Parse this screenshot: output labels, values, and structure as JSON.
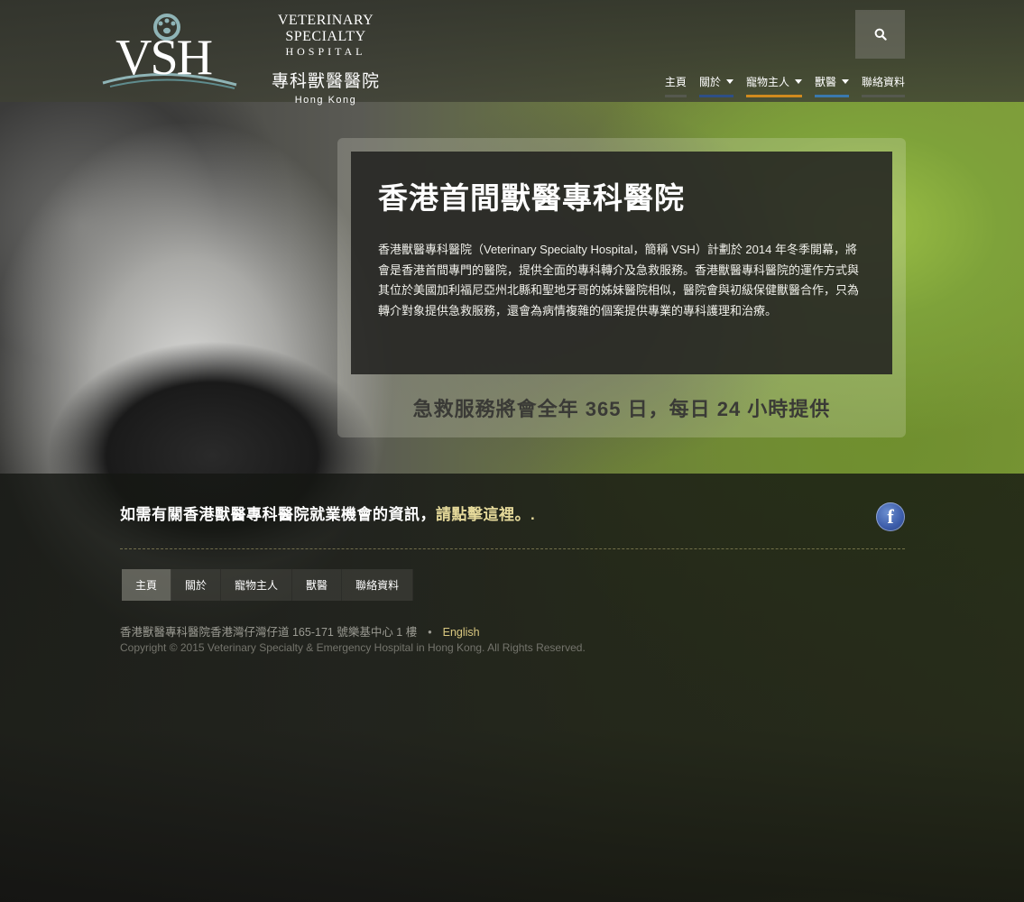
{
  "logo": {
    "mark_text": "VSH",
    "line1": "VETERINARY SPECIALTY",
    "line2": "HOSPITAL",
    "line3": "專科獸醫醫院",
    "line4": "Hong Kong"
  },
  "search": {
    "icon": "search-icon"
  },
  "nav": {
    "items": [
      {
        "label": "主頁",
        "has_dropdown": false,
        "bar_color": "#55584e"
      },
      {
        "label": "關於",
        "has_dropdown": true,
        "bar_color": "#2e4f86"
      },
      {
        "label": "寵物主人",
        "has_dropdown": true,
        "bar_color": "#d08a1e"
      },
      {
        "label": "獸醫",
        "has_dropdown": true,
        "bar_color": "#3a78ad"
      },
      {
        "label": "聯絡資料",
        "has_dropdown": false,
        "bar_color": "#55584e"
      }
    ]
  },
  "hero": {
    "title": "香港首間獸醫專科醫院",
    "body": "香港獸醫專科醫院（Veterinary Specialty Hospital，簡稱 VSH）計劃於 2014 年冬季開幕，將會是香港首間專門的醫院，提供全面的專科轉介及急救服務。香港獸醫專科醫院的運作方式與其位於美國加利福尼亞州北縣和聖地牙哥的姊妹醫院相似，醫院會與初級保健獸醫合作，只為轉介對象提供急救服務，還會為病情複雜的個案提供專業的專科護理和治療。",
    "tagline": "急救服務將會全年 365 日，每日 24 小時提供"
  },
  "footer": {
    "career_text": "如需有關香港獸醫專科醫院就業機會的資訊，",
    "career_link": "請點擊這裡",
    "career_end": "。.",
    "facebook_icon": "f",
    "nav": [
      "主頁",
      "關於",
      "寵物主人",
      "獸醫",
      "聯絡資料"
    ],
    "address": "香港獸醫專科醫院香港灣仔灣仔道 165-171 號樂基中心 1 樓",
    "separator": "•",
    "english_link": "English",
    "copyright": "Copyright © 2015 Veterinary Specialty & Emergency Hospital in Hong Kong. All Rights Reserved."
  },
  "colors": {
    "accent_link": "#e5d99a",
    "facebook_blue": "#3b5ba8"
  }
}
